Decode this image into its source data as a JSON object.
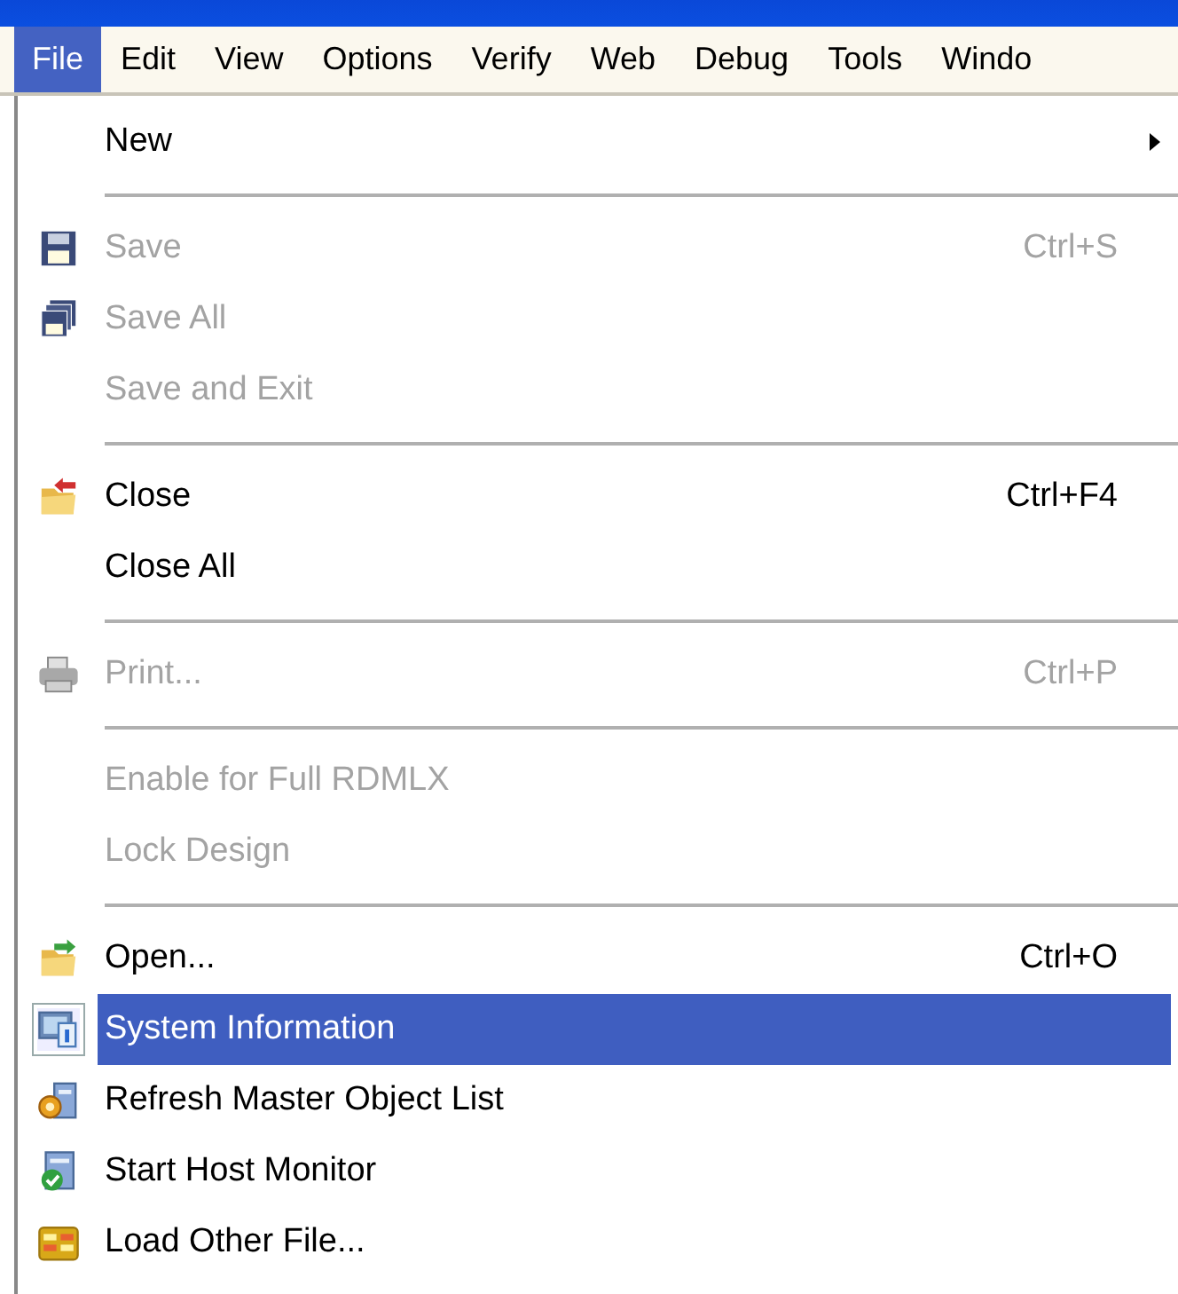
{
  "menu_bar": [
    {
      "label": "File",
      "selected": true
    },
    {
      "label": "Edit",
      "selected": false
    },
    {
      "label": "View",
      "selected": false
    },
    {
      "label": "Options",
      "selected": false
    },
    {
      "label": "Verify",
      "selected": false
    },
    {
      "label": "Web",
      "selected": false
    },
    {
      "label": "Debug",
      "selected": false
    },
    {
      "label": "Tools",
      "selected": false
    },
    {
      "label": "Windo",
      "selected": false
    }
  ],
  "file_menu": [
    {
      "kind": "item",
      "label": "New",
      "disabled": false,
      "selected": false,
      "submenu": true
    },
    {
      "kind": "separator"
    },
    {
      "kind": "item",
      "label": "Save",
      "shortcut": "Ctrl+S",
      "disabled": true,
      "selected": false,
      "submenu": false
    },
    {
      "kind": "item",
      "label": "Save All",
      "disabled": true,
      "selected": false,
      "submenu": false
    },
    {
      "kind": "item",
      "label": "Save and Exit",
      "disabled": true,
      "selected": false,
      "submenu": false
    },
    {
      "kind": "separator"
    },
    {
      "kind": "item",
      "label": "Close",
      "shortcut": "Ctrl+F4",
      "disabled": false,
      "selected": false,
      "submenu": false
    },
    {
      "kind": "item",
      "label": "Close All",
      "disabled": false,
      "selected": false,
      "submenu": false
    },
    {
      "kind": "separator"
    },
    {
      "kind": "item",
      "label": "Print...",
      "shortcut": "Ctrl+P",
      "disabled": true,
      "selected": false,
      "submenu": false
    },
    {
      "kind": "separator"
    },
    {
      "kind": "item",
      "label": "Enable for Full RDMLX",
      "disabled": true,
      "selected": false,
      "submenu": false
    },
    {
      "kind": "item",
      "label": "Lock Design",
      "disabled": true,
      "selected": false,
      "submenu": false
    },
    {
      "kind": "separator"
    },
    {
      "kind": "item",
      "label": "Open...",
      "shortcut": "Ctrl+O",
      "disabled": false,
      "selected": false,
      "submenu": false
    },
    {
      "kind": "item",
      "label": "System Information",
      "disabled": false,
      "selected": true,
      "submenu": false
    },
    {
      "kind": "item",
      "label": "Refresh Master Object List",
      "disabled": false,
      "selected": false,
      "submenu": false
    },
    {
      "kind": "item",
      "label": "Start Host Monitor",
      "disabled": false,
      "selected": false,
      "submenu": false
    },
    {
      "kind": "item",
      "label": "Load Other File...",
      "disabled": false,
      "selected": false,
      "submenu": false
    }
  ]
}
